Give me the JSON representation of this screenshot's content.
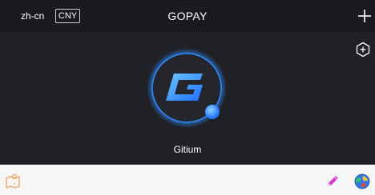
{
  "header": {
    "language": "zh-cn",
    "currency": "CNY",
    "title": "GOPAY"
  },
  "wallet": {
    "name": "Gitium"
  },
  "icons": {
    "add": "plus-icon",
    "add_wallet": "hexagon-plus-icon",
    "logo": "gitium-logo-icon",
    "map": "map-pin-icon",
    "edit": "pencil-icon",
    "globe": "globe-icon"
  },
  "colors": {
    "header_bg": "#1a1b20",
    "main_bg": "#1f2127",
    "bottom_bg": "#f6f6f6",
    "accent_blue": "#2f8cff",
    "map_icon": "#f3a35b",
    "pen_icon": "#d63ad8"
  }
}
